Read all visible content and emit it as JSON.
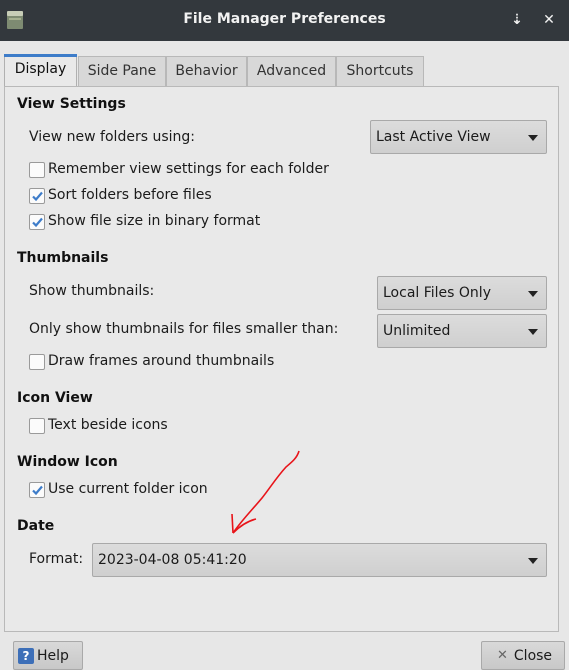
{
  "window": {
    "title": "File Manager Preferences",
    "pin_glyph": "⇣",
    "close_glyph": "✕"
  },
  "tabs": [
    {
      "label": "Display",
      "active": true
    },
    {
      "label": "Side Pane",
      "active": false
    },
    {
      "label": "Behavior",
      "active": false
    },
    {
      "label": "Advanced",
      "active": false
    },
    {
      "label": "Shortcuts",
      "active": false
    }
  ],
  "view_settings": {
    "title": "View Settings",
    "view_new_folders_label": "View new folders using:",
    "view_new_folders_value": "Last Active View",
    "remember_label": "Remember view settings for each folder",
    "remember_checked": false,
    "sort_folders_label": "Sort folders before files",
    "sort_folders_checked": true,
    "binary_size_label": "Show file size in binary format",
    "binary_size_checked": true
  },
  "thumbnails": {
    "title": "Thumbnails",
    "show_label": "Show thumbnails:",
    "show_value": "Local Files Only",
    "smaller_label": "Only show thumbnails for files smaller than:",
    "smaller_value": "Unlimited",
    "frames_label": "Draw frames around thumbnails",
    "frames_checked": false
  },
  "icon_view": {
    "title": "Icon View",
    "text_beside_label": "Text beside icons",
    "text_beside_checked": false
  },
  "window_icon": {
    "title": "Window Icon",
    "current_folder_label": "Use current folder icon",
    "current_folder_checked": true
  },
  "date": {
    "title": "Date",
    "format_label": "Format:",
    "format_value": "2023-04-08 05:41:20"
  },
  "buttons": {
    "help_label": "Help",
    "close_label": "Close"
  },
  "colors": {
    "titlebar": "#33383d",
    "accent": "#3d7cc9",
    "annotation": "#e8141a"
  }
}
